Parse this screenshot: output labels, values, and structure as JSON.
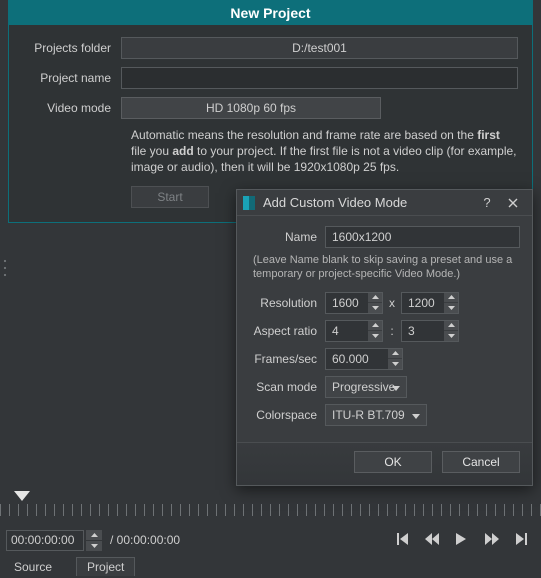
{
  "panel": {
    "title": "New Project",
    "labels": {
      "folder": "Projects folder",
      "name": "Project name",
      "mode": "Video mode"
    },
    "folder_value": "D:/test001",
    "name_value": "",
    "mode_value": "HD 1080p 60 fps",
    "help_pre": "Automatic means the resolution and frame rate are based on the ",
    "help_bold1": "first",
    "help_mid": " file you ",
    "help_bold2": "add",
    "help_post": " to your project. If the first file is not a video clip (for example, image or audio), then it will be 1920x1080p 25 fps.",
    "start_label": "Start"
  },
  "dialog": {
    "title": "Add Custom Video Mode",
    "labels": {
      "name": "Name",
      "resolution": "Resolution",
      "aspect": "Aspect ratio",
      "fps": "Frames/sec",
      "scan": "Scan mode",
      "colorspace": "Colorspace"
    },
    "name_value": "1600x1200",
    "hint": "(Leave Name blank to skip saving a preset and use a temporary or project-specific Video Mode.)",
    "res_w": "1600",
    "res_h": "1200",
    "res_sep": "x",
    "aspect_w": "4",
    "aspect_h": "3",
    "aspect_sep": ":",
    "fps_value": "60.000",
    "scan_value": "Progressive",
    "colorspace_value": "ITU-R BT.709",
    "ok_label": "OK",
    "cancel_label": "Cancel"
  },
  "playbar": {
    "timecode": "00:00:00:00",
    "duration": "/ 00:00:00:00"
  },
  "tabs": {
    "source": "Source",
    "project": "Project"
  }
}
